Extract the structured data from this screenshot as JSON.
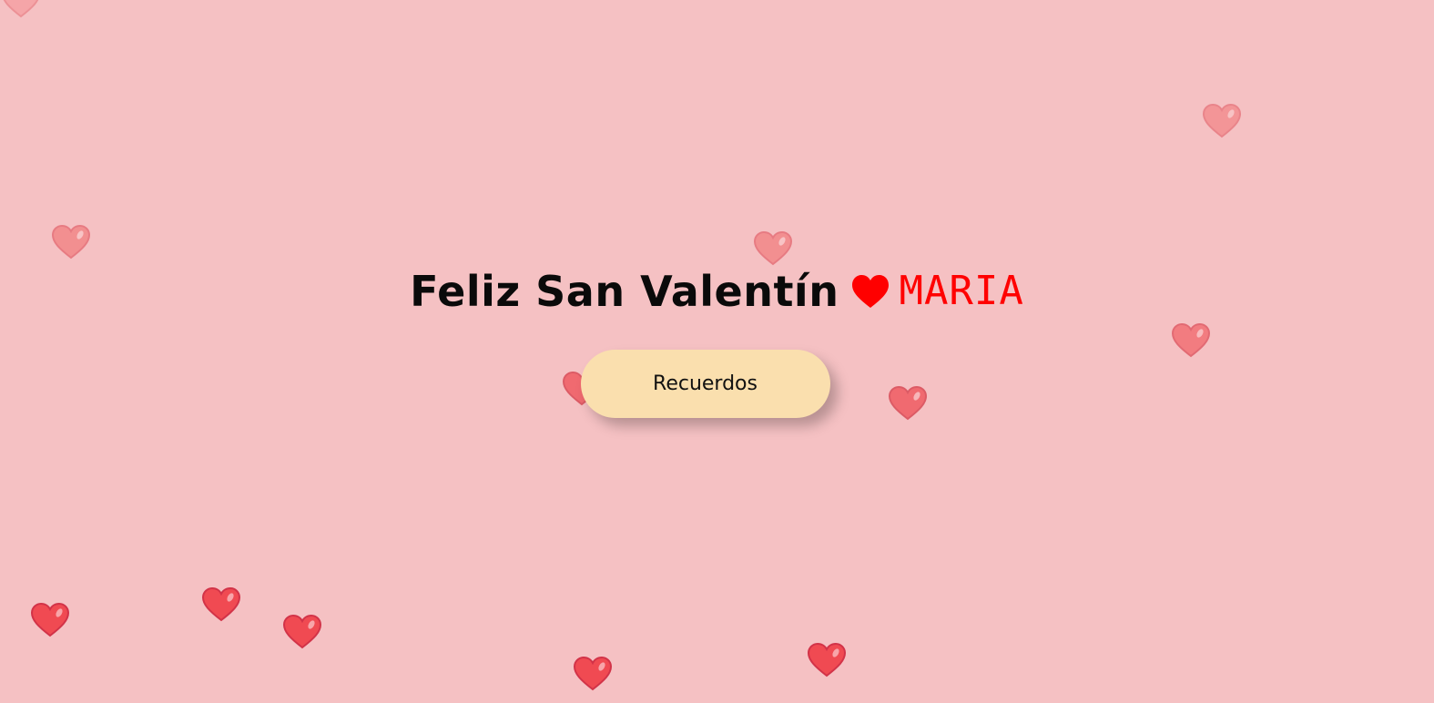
{
  "headline": {
    "text": "Feliz San Valentín",
    "heart_icon": "heart-icon",
    "name": "MARIA",
    "name_color": "#ff0000"
  },
  "button": {
    "label": "Recuerdos",
    "background": "#fadfae"
  },
  "background_color": "#f5c1c3",
  "floating_hearts": {
    "icon": "heart-icon",
    "count": 13,
    "colors": [
      "#f27f80",
      "#f04a52"
    ]
  }
}
